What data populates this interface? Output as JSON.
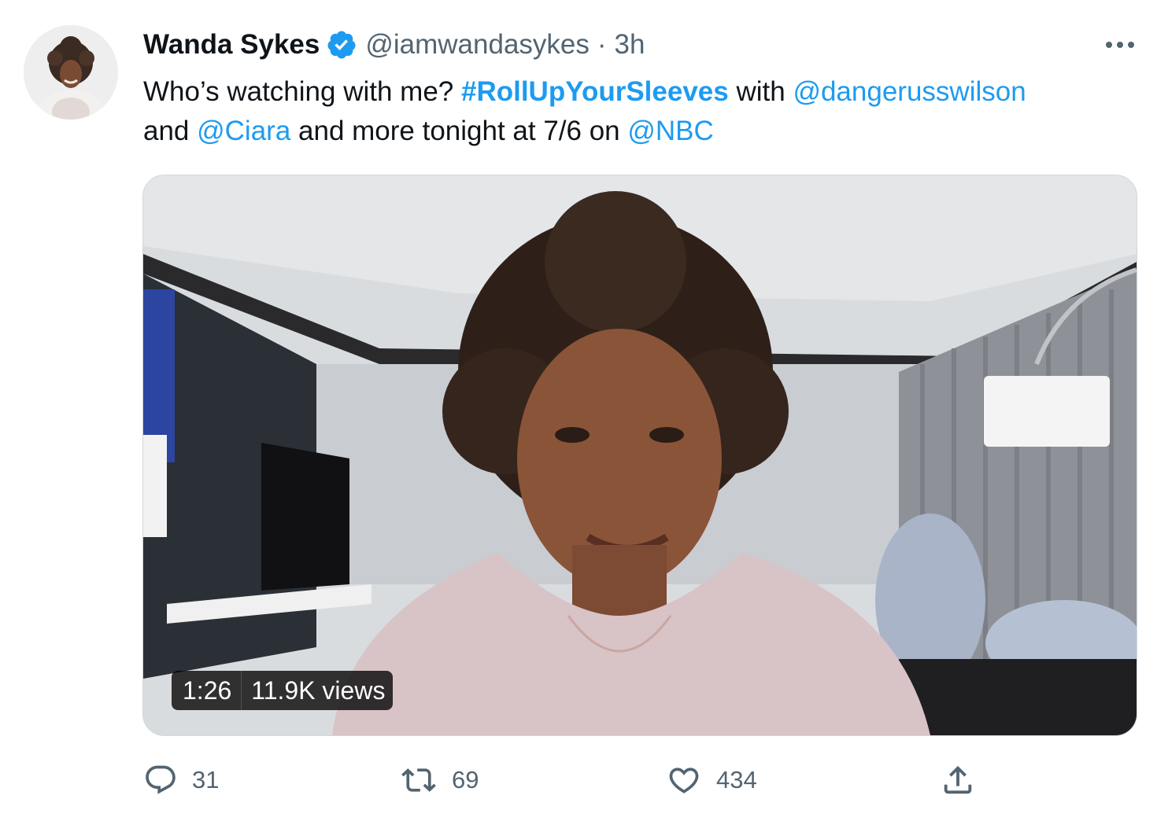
{
  "author": {
    "display_name": "Wanda Sykes",
    "handle": "@iamwandasykes",
    "separator": "·",
    "time": "3h",
    "verified": true,
    "avatar_icon": "avatar-photo"
  },
  "tweet": {
    "line1_prefix": "Who’s watching with me? ",
    "hashtag": "#RollUpYourSleeves",
    "line1_mid": " with ",
    "mention1": "@dangerusswilson",
    "line2_prefix": "and ",
    "mention2": "@Ciara",
    "line2_mid": " and more tonight at 7/6 on ",
    "mention3": "@NBC"
  },
  "media": {
    "type": "video",
    "duration": "1:26",
    "views": "11.9K views"
  },
  "actions": {
    "reply": {
      "icon": "reply-icon",
      "count": "31"
    },
    "retweet": {
      "icon": "retweet-icon",
      "count": "69"
    },
    "like": {
      "icon": "heart-icon",
      "count": "434"
    },
    "share": {
      "icon": "share-icon"
    }
  },
  "colors": {
    "link": "#1d9bf0",
    "muted": "#536471",
    "text": "#0f1419",
    "verified": "#1d9bf0"
  }
}
